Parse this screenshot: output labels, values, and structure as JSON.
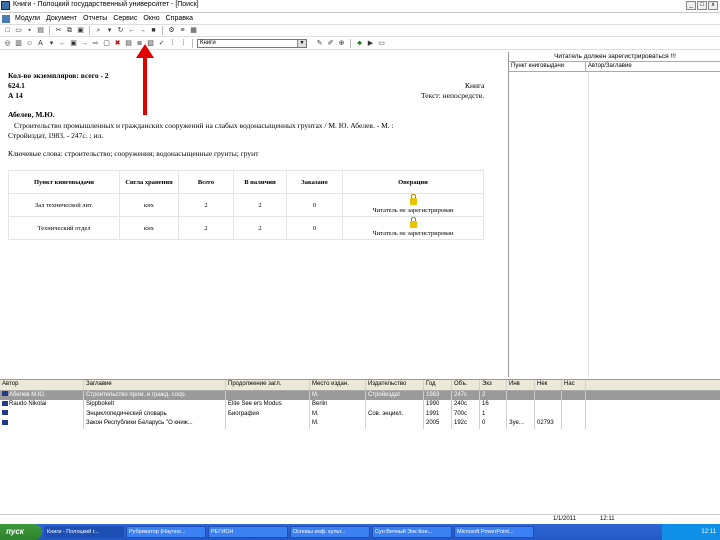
{
  "window": {
    "title": "Книги - Полоцкий государственный университет - [Поиск]"
  },
  "menu": [
    "Модули",
    "Документ",
    "Отчеты",
    "Сервис",
    "Окно",
    "Справка"
  ],
  "toolbar2": {
    "combo_value": "Книги"
  },
  "detail": {
    "copies": "Кол-во экземпляров: всего - 2",
    "udc": "624.1",
    "index": "А 14",
    "type_right": "Книга",
    "type_right2": "Текст: непосредств.",
    "author": "Абелев, М.Ю.",
    "title_line": "Строительство промышленных и гражданских сооружений на слабых водонасыщенных грунтах / М. Ю. Абелев. - М. :",
    "pub_line": "Стройиздат, 1983. - 247с. : ил.",
    "keywords": "Ключевые слова: строительство; сооружения; водонасыщенные грунты; грунт"
  },
  "holdings": {
    "headers": [
      "Пункт книговыдачи",
      "Сигла хранения",
      "Всего",
      "В наличии",
      "Заказано",
      "Операции"
    ],
    "rows": [
      {
        "point": "Зал технической лит.",
        "sigla": "кнх",
        "total": "2",
        "available": "2",
        "ordered": "0",
        "op": "Читатель не зарегистрирован"
      },
      {
        "point": "Технический отдел",
        "sigla": "кнх",
        "total": "2",
        "available": "2",
        "ordered": "0",
        "op": "Читатель не зарегистрирован"
      }
    ]
  },
  "right_panel": {
    "title": "Читатель должен зарегистрироваться !!!",
    "headers": [
      "Пункт книговыдачи",
      "Автор/Заглавие"
    ]
  },
  "grid": {
    "headers": [
      "Автор",
      "Заглавие",
      "Продолжение загл.",
      "Место издан.",
      "Издательство",
      "Год",
      "Объ.",
      "Экз",
      "Инв",
      "Нек",
      "Нас"
    ],
    "rows": [
      [
        "Абелев М.Ю.",
        "Строительство пром. и гражд. соор.",
        "",
        "М.",
        "Стройиздат",
        "1983",
        "247с",
        "2",
        "",
        "",
        ""
      ],
      [
        "Raudo Nikolai",
        "Sippbokelt",
        "Elite See ers Modus",
        "Berlin",
        "",
        "1990",
        "240с",
        "16",
        "",
        "",
        ""
      ],
      [
        "",
        "Энциклопедический словарь",
        "Биография",
        "М.",
        "Сов. энцикл.",
        "1991",
        "700с",
        "1",
        "",
        "",
        ""
      ],
      [
        "",
        "Закон Республики Беларусь \"О книж...",
        "",
        "М.",
        "",
        "2005",
        "192с",
        "0",
        "Зуе...",
        "02793",
        ""
      ]
    ]
  },
  "statusbar": {
    "date": "1/1/2011",
    "time": "12:11"
  },
  "taskbar": {
    "start": "пуск",
    "tasks": [
      "Книги - Полоцкий г...",
      "Рубрикатор (Научно...",
      "РЕГИОН",
      "Основы инф. культ...",
      "Сун Вечный Энк Кни...",
      "Microsoft PowerPoint..."
    ],
    "clock": "12:11"
  }
}
